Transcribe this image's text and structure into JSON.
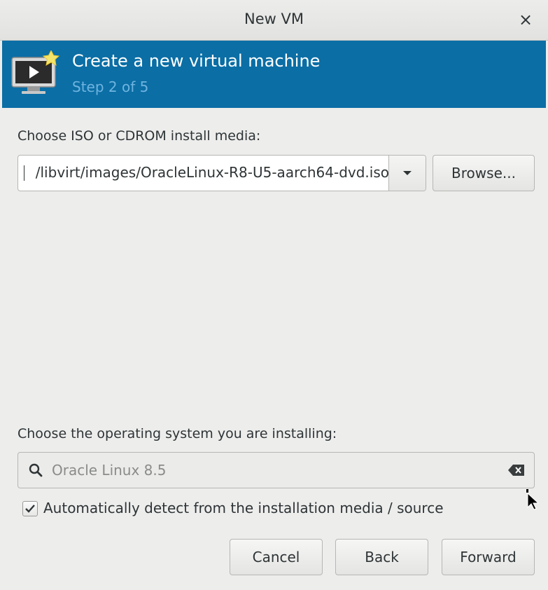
{
  "window": {
    "title": "New VM",
    "close_glyph": "×"
  },
  "header": {
    "title": "Create a new virtual machine",
    "step": "Step 2 of 5",
    "icon": "vm-display-icon",
    "accent_color": "#0b6ea5"
  },
  "install_media": {
    "label": "Choose ISO or CDROM install media:",
    "value": "/libvirt/images/OracleLinux-R8-U5-aarch64-dvd.iso",
    "browse_label": "Browse..."
  },
  "os": {
    "label": "Choose the operating system you are installing:",
    "search_placeholder": "Oracle Linux 8.5",
    "auto_detect_label": "Automatically detect from the installation media / source",
    "auto_detect_checked": true
  },
  "buttons": {
    "cancel": "Cancel",
    "back": "Back",
    "forward": "Forward"
  }
}
